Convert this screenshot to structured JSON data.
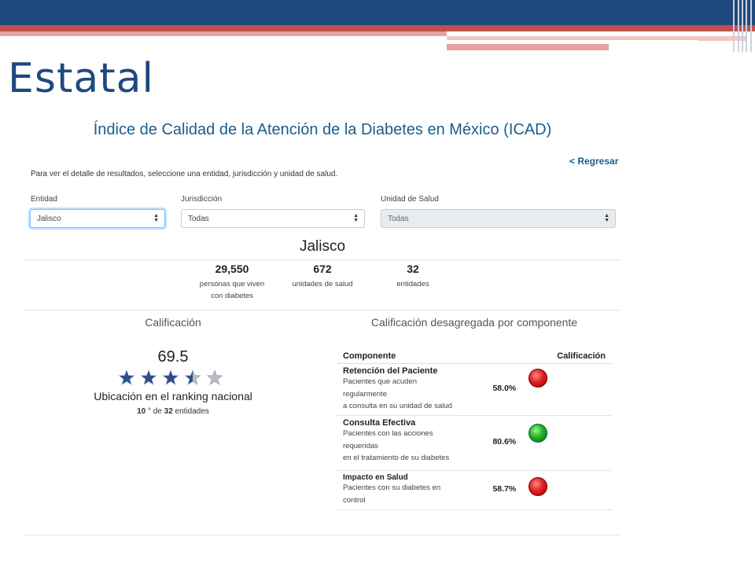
{
  "slide": {
    "title": "Estatal"
  },
  "app": {
    "title": "Índice de Calidad de la Atención de la Diabetes en México (ICAD)",
    "back_link": "< Regresar",
    "instructions": "Para ver el detalle de resultados, seleccione una entidad, jurisdicción y unidad de salud."
  },
  "filters": {
    "entidad": {
      "label": "Entidad",
      "value": "Jalisco"
    },
    "jurisdiccion": {
      "label": "Jurisdicción",
      "value": "Todas"
    },
    "unidad": {
      "label": "Unidad de Salud",
      "value": "Todas"
    }
  },
  "entity": {
    "name": "Jalisco",
    "stats": [
      {
        "value": "29,550",
        "label_line1": "personas que viven",
        "label_line2": "con diabetes"
      },
      {
        "value": "672",
        "label_line1": "unidades de salud",
        "label_line2": ""
      },
      {
        "value": "32",
        "label_line1": "entidades",
        "label_line2": ""
      }
    ]
  },
  "calificacion": {
    "heading": "Calificación",
    "score": "69.5",
    "stars_rating": 3.5,
    "stars_max": 5,
    "ranking_title": "Ubicación en el ranking nacional",
    "ranking_position": "10",
    "ranking_mid": " ° de ",
    "ranking_total": "32",
    "ranking_suffix": " entidades"
  },
  "desagregada": {
    "heading": "Calificación desagregada por componente",
    "col_componente": "Componente",
    "col_calificacion": "Calificación",
    "rows": [
      {
        "title": "Retención del Paciente",
        "desc1": "Pacientes que acuden",
        "desc2": "regularmente",
        "desc3": "a consulta en su unidad de salud",
        "pct": "58.0%",
        "status": "red"
      },
      {
        "title": "Consulta Efectiva",
        "desc1": "Pacientes con las acciones",
        "desc2": "requeridas",
        "desc3": "en el tratamiento de su diabetes",
        "pct": "80.6%",
        "status": "green"
      },
      {
        "title": "Impacto en Salud",
        "desc1": "Pacientes con su diabetes en",
        "desc2": "control",
        "desc3": "",
        "pct": "58.7%",
        "status": "red"
      }
    ]
  },
  "colors": {
    "header_blue": "#1f497d",
    "header_red": "#c0504d",
    "link_blue": "#1a5d8a",
    "star_blue": "#2b4d8f",
    "star_gray": "#bbbbbb"
  }
}
